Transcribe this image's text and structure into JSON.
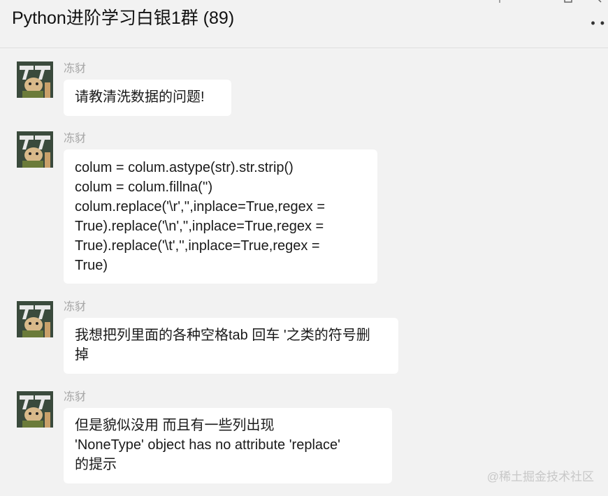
{
  "header": {
    "title": "Python进阶学习白银1群 (89)",
    "more_icon": "more-dots-icon"
  },
  "messages": [
    {
      "sender": "冻豺",
      "lines": [
        "请教清洗数据的问题!"
      ]
    },
    {
      "sender": "冻豺",
      "lines": [
        "colum = colum.astype(str).str.strip()",
        "colum = colum.fillna('')",
        "colum.replace('\\r','',inplace=True,regex =",
        "True).replace('\\n','',inplace=True,regex =",
        "True).replace('\\t','',inplace=True,regex =",
        "True)"
      ]
    },
    {
      "sender": "冻豺",
      "lines": [
        "我想把列里面的各种空格tab 回车 '之类的符号删",
        "掉"
      ]
    },
    {
      "sender": "冻豺",
      "lines": [
        "但是貌似没用 而且有一些列出现",
        "'NoneType' object has no attribute 'replace'",
        "的提示"
      ]
    }
  ],
  "watermark": "@稀土掘金技术社区",
  "colors": {
    "background": "#f2f2f2",
    "bubble": "#ffffff",
    "sender": "#a6a6a6"
  }
}
